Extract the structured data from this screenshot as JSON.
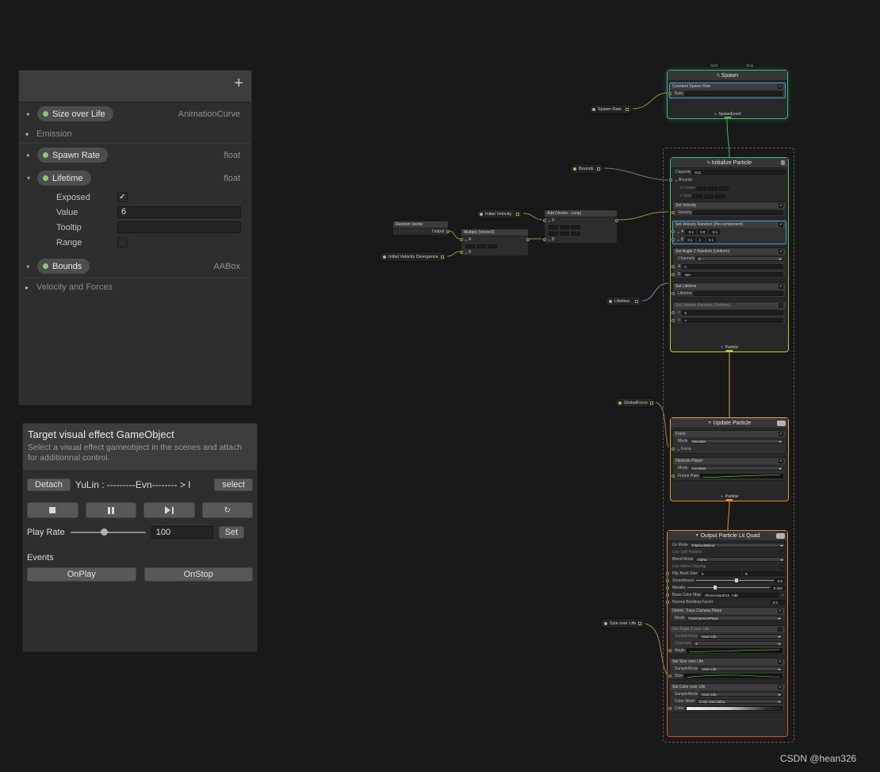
{
  "watermark": "CSDN @hean326",
  "icons": {
    "add": "+",
    "spark": "ϟ",
    "flow": "▼",
    "expand": "▸",
    "collapse": "▾",
    "check": "✓",
    "menu": "⋯",
    "restart": "↻"
  },
  "colors": {
    "flow_green": "#2bc264",
    "flow_yellow": "#d9a43c",
    "flow_orange": "#e0912e",
    "edge_olive": "#8f8f4a",
    "edge_blue": "#6d93a8",
    "edge_gray": "#7a7a7a",
    "selection_blue": "#3e9bd8",
    "param_dot_green": "#8cc96c"
  },
  "blackboard": {
    "size_over_life": {
      "label": "Size over Life",
      "type": "AnimationCurve"
    },
    "emission": {
      "label": "Emission"
    },
    "spawn_rate": {
      "label": "Spawn Rate",
      "type": "float"
    },
    "lifetime": {
      "label": "Lifetime",
      "type": "float"
    },
    "lifetime_detail": {
      "exposed_label": "Exposed",
      "value_label": "Value",
      "value": "6",
      "tooltip_label": "Tooltip",
      "range_label": "Range"
    },
    "bounds": {
      "label": "Bounds",
      "type": "AABox"
    },
    "velocity_and_forces": {
      "label": "Velocity and Forces"
    }
  },
  "target": {
    "title": "Target visual effect GameObject",
    "subtitle": "Select a visual effect gameobject in the scenes and attach for additionnal control.",
    "detach": "Detach",
    "object_name": "YuLin : ---------Evn-------- > I",
    "select": "select",
    "play_rate_label": "Play Rate",
    "play_rate_value": "100",
    "set": "Set",
    "events_label": "Events",
    "onplay": "OnPlay",
    "onstop": "OnStop"
  },
  "graph": {
    "spawn": {
      "title": "Spawn",
      "start": "Start",
      "stop": "Stop",
      "block_title": "Constant Spawn Rate",
      "rate": "Rate",
      "flow_out": "SpawnEvent"
    },
    "params": {
      "spawn_rate": "Spawn Rate",
      "bounds": "Bounds",
      "initial_velocity": "Initial Velocity",
      "initial_velocity_divergence": "Initial Velocity Divergence",
      "lifetime": "Lifetime",
      "global_force": "GlobalForce",
      "size_over_life": "Size over Life"
    },
    "random_vector": {
      "title": "Random Vector",
      "output": "Output"
    },
    "multiply": {
      "title": "Multiply (Vector3)",
      "a": "A",
      "b": "B"
    },
    "add": {
      "title": "Add (Vector - Loop)",
      "a": "A",
      "b": "B"
    },
    "initialize": {
      "title": "Initialize Particle",
      "capacity_label": "Capacity",
      "capacity": "512",
      "bounds": "Bounds",
      "b_center": "b Center",
      "b_size": "x Size",
      "set_velocity_title": "Set Velocity",
      "velocity": "Velocity",
      "set_velocity_random_title": "Set Velocity Random (Per-component)",
      "a": "A",
      "b": "B",
      "a_values": [
        "-0.1",
        "0.8",
        "-0.1"
      ],
      "b_values": [
        "0.1",
        "1",
        "0.1"
      ],
      "set_angle_title": "Set Angle Z Random (Uniform)",
      "channels_label": "Channels",
      "channels": "Z",
      "angle_a": "0",
      "angle_b": "360",
      "set_lifetime_title": "Set Lifetime",
      "lifetime_label": "Lifetime",
      "set_lifetime_random_title": "Set Lifetime Random (Uniform)",
      "lr_a": "5",
      "lr_b": "7",
      "flow_out": "Particle"
    },
    "update": {
      "title": "Update Particle",
      "force_title": "Force",
      "mode_label": "Mode",
      "force_mode": "Absolute",
      "force_label": "Force",
      "flipbook_title": "Flipbook Player",
      "flipbook_mode": "Constant",
      "frame_rate_label": "Frame Rate",
      "flow_out": "Particle"
    },
    "output": {
      "title": "Output Particle Lit Quad",
      "settings": [
        {
          "label": "Uv Mode",
          "value": "FlipbookBlend"
        },
        {
          "label": "Use Soft Particle"
        },
        {
          "label": "Blend Mode",
          "value": "Alpha"
        },
        {
          "label": "Use Alpha Clipping"
        },
        {
          "label": "Flip Book Size",
          "x": "8",
          "y": "8"
        },
        {
          "label": "Smoothness",
          "value": "0.5"
        },
        {
          "label": "Metallic",
          "value": "0.325"
        },
        {
          "label": "Base Color Map",
          "value": "ShuiyinxiaoD16_AdE"
        },
        {
          "label": "Normal Bending Factor",
          "value": "0.1"
        }
      ],
      "orient_title": "Orient : Face Camera Plane",
      "mode_label": "Mode",
      "orient_mode": "FaceCameraPlane",
      "angle_title": "Set Angle Z over Life",
      "sample_mode_label": "SampleMode",
      "sample_mode": "Over Life",
      "channels_label": "Channels",
      "channels": "Z",
      "angle_label": "Angle",
      "size_title": "Set Size over Life",
      "size_label": "Size",
      "color_title": "Set Color over Life",
      "color_mode_label": "Color Mode",
      "color_mode": "Color And Alpha",
      "color_label": "Color"
    }
  }
}
